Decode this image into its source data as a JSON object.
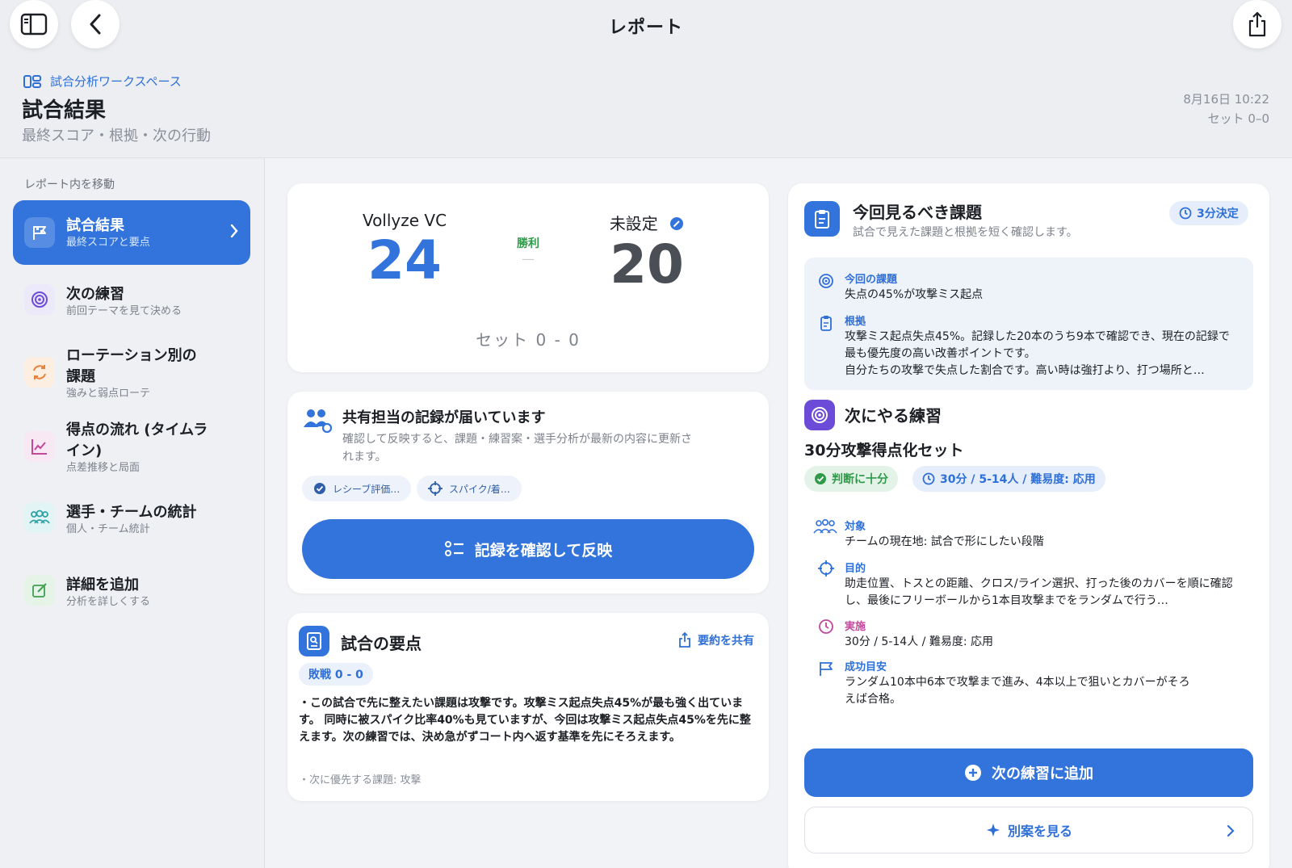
{
  "nav": {
    "title": "レポート"
  },
  "header": {
    "workspace": "試合分析ワークスペース",
    "title": "試合結果",
    "subtitle": "最終スコア・根拠・次の行動",
    "date": "8月16日 10:22",
    "set": "セット 0–0"
  },
  "sidebar": {
    "heading": "レポート内を移動",
    "items": [
      {
        "title": "試合結果",
        "sub": "最終スコアと要点"
      },
      {
        "title": "次の練習",
        "sub": "前回テーマを見て決める"
      },
      {
        "title": "ローテーション別の課題",
        "sub": "強みと弱点ローテ"
      },
      {
        "title": "得点の流れ (タイムライン)",
        "sub": "点差推移と局面"
      },
      {
        "title": "選手・チームの統計",
        "sub": "個人・チーム統計"
      },
      {
        "title": "詳細を追加",
        "sub": "分析を詳しくする"
      }
    ]
  },
  "score": {
    "home_name": "Vollyze VC",
    "home_score": "24",
    "away_name": "未設定",
    "away_score": "20",
    "result": "勝利",
    "dash": "—",
    "set_line": "セット 0 - 0"
  },
  "share": {
    "title": "共有担当の記録が届いています",
    "desc": "確認して反映すると、課題・練習案・選手分析が最新の内容に更新されます。",
    "chips": [
      "レシーブ評価…",
      "スパイク/着…"
    ],
    "button": "記録を確認して反映"
  },
  "summary": {
    "title": "試合の要点",
    "share_label": "要約を共有",
    "badge": "敗戦 0 - 0",
    "body": "・この試合で先に整えたい課題は攻撃です。攻撃ミス起点失点45%が最も強く出ています。 同時に被スパイク比率40%も見ていますが、今回は攻撃ミス起点失点45%を先に整えます。次の練習では、決め急がずコート内へ返す基準を先にそろえます。",
    "note": "・次に優先する課題: 攻撃"
  },
  "issue": {
    "title": "今回見るべき課題",
    "sub": "試合で見えた課題と根拠を短く確認します。",
    "pill": "3分決定",
    "current_label": "今回の課題",
    "current_value": "失点の45%が攻撃ミス起点",
    "basis_label": "根拠",
    "basis_value": "攻撃ミス起点失点45%。記録した20本のうち9本で確認でき、現在の記録で最も優先度の高い改善ポイントです。",
    "basis_extra": "自分たちの攻撃で失点した割合です。高い時は強打より、打つ場所と…"
  },
  "practice": {
    "title": "次にやる練習",
    "name": "30分攻撃得点化セット",
    "badge_ok": "判断に十分",
    "badge_meta": "30分 / 5-14人 / 難易度: 応用",
    "target_label": "対象",
    "target_value": "チームの現在地: 試合で形にしたい段階",
    "goal_label": "目的",
    "goal_value": "助走位置、トスとの距離、クロス/ライン選択、打った後のカバーを順に確認し、最後にフリーボールから1本目攻撃までをランダムで行う…",
    "exec_label": "実施",
    "exec_value": "30分 / 5-14人 / 難易度: 応用",
    "success_label": "成功目安",
    "success_value": "ランダム10本中6本で攻撃まで進み、4本以上で狙いとカバーがそろえば合格。",
    "add_button": "次の練習に追加",
    "alt_button": "別案を見る"
  },
  "colors": {
    "accent": "#3274dc",
    "success": "#2f9a4a",
    "background": "#f1f3f6"
  },
  "icons": [
    "sidebar-toggle-icon",
    "back-chevron-icon",
    "share-icon",
    "workspace-icon",
    "flag-icon",
    "target-icon",
    "rotation-icon",
    "chart-icon",
    "people-icon",
    "edit-icon",
    "clipboard-icon",
    "timer-icon",
    "plus-circle-icon",
    "sparkle-icon"
  ]
}
